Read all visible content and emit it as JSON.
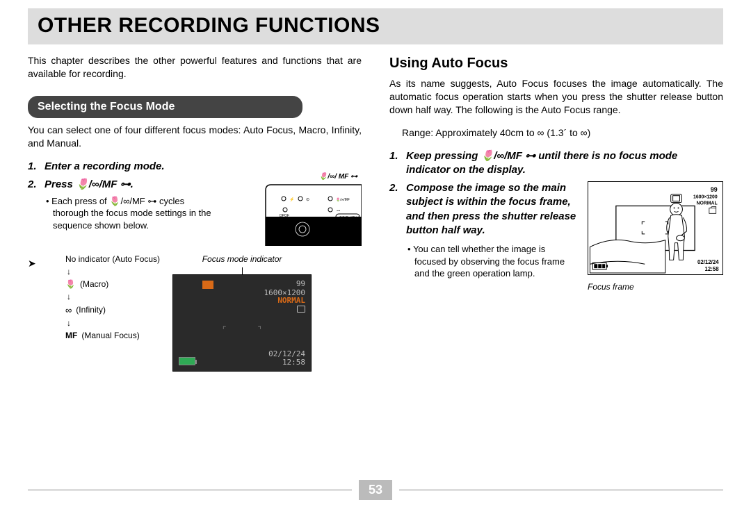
{
  "page": {
    "title": "OTHER RECORDING FUNCTIONS",
    "number": "53"
  },
  "intro": "This chapter describes the other powerful features and functions that are available for recording.",
  "left": {
    "section_heading": "Selecting the Focus Mode",
    "section_desc": "You can select one of four different focus modes: Auto Focus, Macro, Infinity, and Manual.",
    "step1": "Enter a recording mode.",
    "step2_prefix": "Press ",
    "step2_icons": "🌷/∞/MF ⊶",
    "step2_suffix": ".",
    "camera_label": "🌷/∞/ MF ⊶",
    "bullet_prefix": "Each press of ",
    "bullet_icons": "🌷/∞/MF ⊶",
    "bullet_suffix": " cycles thorough the focus mode settings in the sequence shown below.",
    "cycle": {
      "auto": "No indicator (Auto Focus)",
      "macro_icon": "🌷",
      "macro": "(Macro)",
      "infinity_icon": "∞",
      "infinity": "(Infinity)",
      "mf_bold": "MF",
      "mf": "(Manual Focus)"
    },
    "monitor_caption": "Focus mode indicator",
    "lcd": {
      "count": "99",
      "res": "1600×1200",
      "normal": "NORMAL",
      "date": "02/12/24",
      "time": "12:58"
    }
  },
  "right": {
    "heading": "Using Auto Focus",
    "desc": "As its name suggests, Auto Focus focuses the image automatically. The automatic focus operation starts when you press the shutter release button down half way. The following is the Auto Focus range.",
    "range": "Range: Approximately 40cm to ∞ (1.3´ to ∞)",
    "step1_prefix": "Keep pressing ",
    "step1_icons": "🌷/∞/MF ⊶",
    "step1_suffix": " until there is no focus mode indicator on the display.",
    "step2": "Compose the image so the main subject is within the focus frame, and then press the shutter release button half way.",
    "step2_bullet": "You can tell whether the image is focused by observing the focus frame and the green operation lamp.",
    "vf": {
      "count": "99",
      "res": "1600×1200",
      "normal": "NORMAL",
      "date": "02/12/24",
      "time": "12:58"
    },
    "vf_caption": "Focus frame"
  }
}
